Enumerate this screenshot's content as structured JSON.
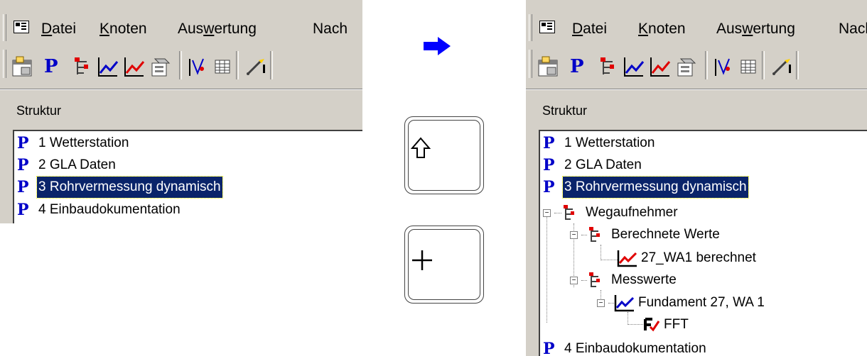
{
  "menu": [
    "Datei",
    "Knoten",
    "Auswertung",
    "Nach"
  ],
  "toolbar": {
    "p_glyph": "P"
  },
  "structure_label": "Struktur",
  "left_tree": [
    {
      "label": "1 Wetterstation"
    },
    {
      "label": "2 GLA Daten"
    },
    {
      "label": "3 Rohrvermessung dynamisch",
      "selected": true
    },
    {
      "label": "4 Einbaudokumentation"
    }
  ],
  "right_tree": [
    {
      "label": "1 Wetterstation",
      "icon": "p-icon"
    },
    {
      "label": "2 GLA Daten",
      "icon": "p-icon"
    },
    {
      "label": "3 Rohrvermessung dynamisch",
      "icon": "p-icon",
      "selected": true
    },
    {
      "label": "Wegaufnehmer",
      "icon": "node-icon",
      "expander": "-"
    },
    {
      "label": "Berechnete Werte",
      "icon": "node-icon",
      "expander": "-"
    },
    {
      "label": "27_WA1 berechnet",
      "icon": "red-chart-icon"
    },
    {
      "label": "Messwerte",
      "icon": "node-icon",
      "expander": "-"
    },
    {
      "label": "Fundament 27, WA 1",
      "icon": "blue-chart-icon",
      "expander": "-"
    },
    {
      "label": "FFT",
      "icon": "fft-icon"
    },
    {
      "label": "4 Einbaudokumentation",
      "icon": "p-icon"
    }
  ],
  "keys": {
    "shift_icon": "shift-arrow-icon",
    "plus_icon": "plus-icon"
  },
  "colors": {
    "selection": "#0a246a",
    "p_blue": "#0000c8",
    "arrow": "#0000ff",
    "node_red": "#e00000"
  }
}
